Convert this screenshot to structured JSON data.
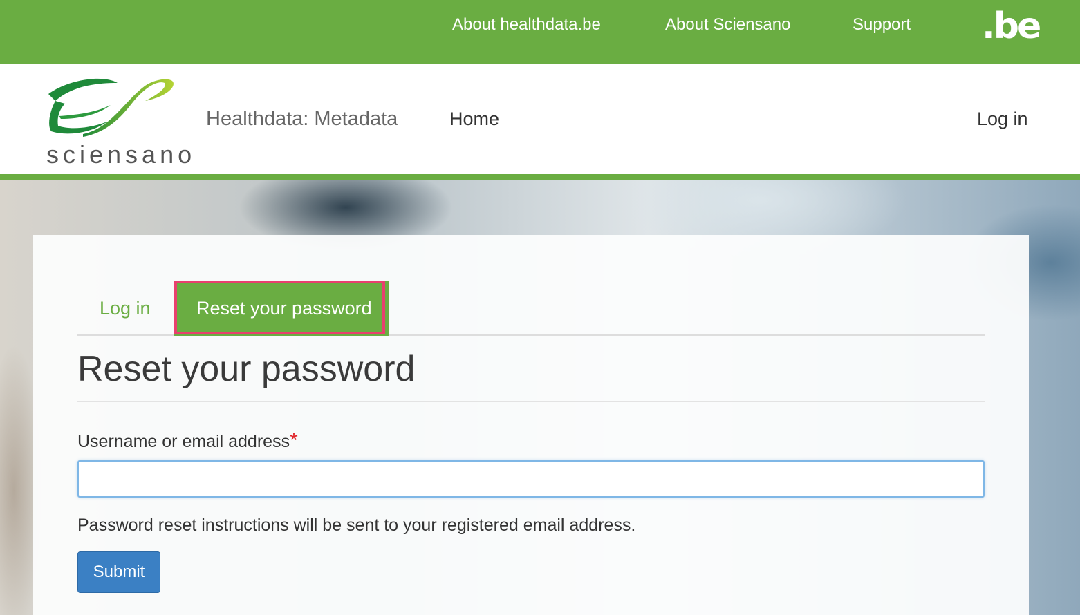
{
  "topbar": {
    "links": [
      "About healthdata.be",
      "About Sciensano",
      "Support"
    ],
    "be_logo": ".be"
  },
  "header": {
    "logo_text": "sciensano",
    "site_name": "Healthdata: Metadata",
    "nav_home": "Home",
    "nav_login": "Log in"
  },
  "tabs": {
    "login": "Log in",
    "reset": "Reset your password"
  },
  "page_title": "Reset your password",
  "form": {
    "field_label": "Username or email address",
    "required_mark": "*",
    "field_value": "",
    "help_text": "Password reset instructions will be sent to your registered email address.",
    "submit_label": "Submit"
  },
  "colors": {
    "brand_green": "#6aad42",
    "highlight": "#e8406e",
    "button_blue": "#3b80c4",
    "required_red": "#e0262b"
  },
  "icons": {
    "logo": "sciensano-leaf-logo",
    "be": "be-logo"
  }
}
